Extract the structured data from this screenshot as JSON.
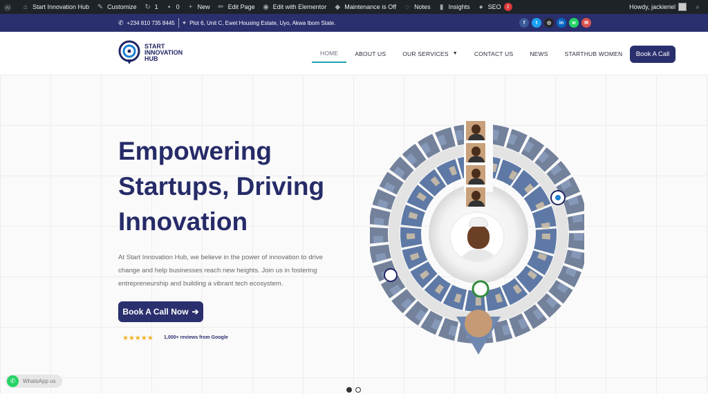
{
  "adminbar": {
    "items": [
      {
        "name": "wp-logo",
        "label": ""
      },
      {
        "name": "site-name",
        "label": "Start Innovation Hub"
      },
      {
        "name": "customize",
        "label": "Customize"
      },
      {
        "name": "updates",
        "label": "1"
      },
      {
        "name": "comments",
        "label": "0"
      },
      {
        "name": "new",
        "label": "New"
      },
      {
        "name": "edit-page",
        "label": "Edit Page"
      },
      {
        "name": "edit-elementor",
        "label": "Edit with Elementor"
      },
      {
        "name": "maintenance",
        "label": "Maintenance is Off"
      },
      {
        "name": "notes",
        "label": "Notes"
      },
      {
        "name": "insights",
        "label": "Insights"
      },
      {
        "name": "seo",
        "label": "SEO",
        "badge": "2"
      }
    ],
    "greeting": "Howdy, jackieriel"
  },
  "topbar": {
    "phone": "+234 810 735 8445",
    "address": "Plot 6, Unit C, Ewet Housing Estate, Uyo, Akwa Ibom State.",
    "socials": [
      {
        "name": "facebook-icon",
        "glyph": "f",
        "color": "#3b5998"
      },
      {
        "name": "twitter-icon",
        "glyph": "t",
        "color": "#1da1f2"
      },
      {
        "name": "instagram-icon",
        "glyph": "◎",
        "color": "#262626"
      },
      {
        "name": "linkedin-icon",
        "glyph": "in",
        "color": "#0a66c2"
      },
      {
        "name": "whatsapp-icon",
        "glyph": "w",
        "color": "#25d366"
      },
      {
        "name": "email-icon",
        "glyph": "✉",
        "color": "#d9534f"
      }
    ]
  },
  "header": {
    "logo_line1": "START",
    "logo_line2": "INNOVATION",
    "logo_line3": "HUB",
    "nav": [
      {
        "label": "HOME",
        "active": true
      },
      {
        "label": "ABOUT US"
      },
      {
        "label": "OUR SERVICES",
        "dropdown": true
      },
      {
        "label": "CONTACT US"
      },
      {
        "label": "NEWS"
      },
      {
        "label": "STARTHUB WOMEN"
      }
    ],
    "cta": "Book A Call"
  },
  "hero": {
    "title_line1": "Empowering",
    "title_line2": "Startups, Driving",
    "title_line3": "Innovation",
    "description": "At Start Innovation Hub, we believe in the power of innovation to drive change and help businesses reach new heights. Join us in fostering entrepreneurship and building a vibrant tech ecosystem.",
    "cta": "Book A Call Now",
    "stars": "★★★★★",
    "reviews": "1,000+ reviews from Google"
  },
  "whatsapp_label": "WhatsApp us",
  "colors": {
    "brand": "#2a2f6e",
    "accent": "#1aa0b0",
    "star": "#f2b01e"
  }
}
